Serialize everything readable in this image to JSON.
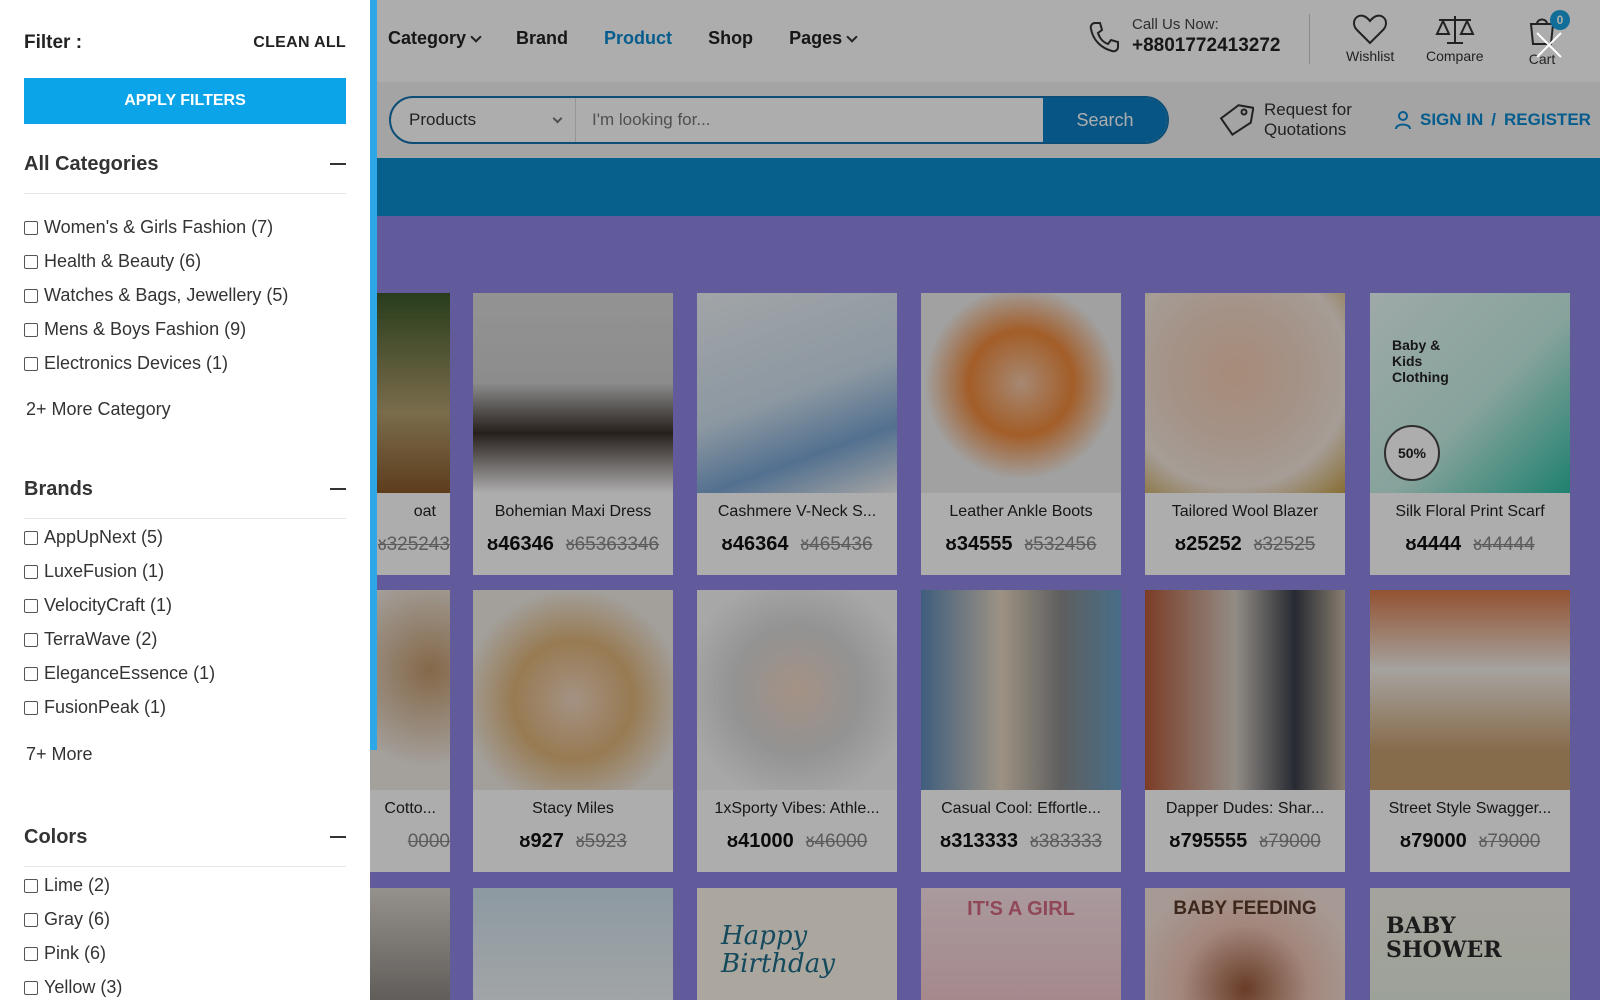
{
  "header": {
    "nav": [
      {
        "label": "Category",
        "dropdown": true,
        "active": false
      },
      {
        "label": "Brand",
        "dropdown": false,
        "active": false
      },
      {
        "label": "Product",
        "dropdown": false,
        "active": true
      },
      {
        "label": "Shop",
        "dropdown": false,
        "active": false
      },
      {
        "label": "Pages",
        "dropdown": true,
        "active": false
      }
    ],
    "call_label": "Call Us Now:",
    "phone": "+8801772413272",
    "wishlist_label": "Wishlist",
    "compare_label": "Compare",
    "cart_label": "Cart",
    "cart_count": "0"
  },
  "search": {
    "category": "Products",
    "placeholder": "I'm looking for...",
    "button": "Search"
  },
  "rfq": {
    "line1": "Request for",
    "line2": "Quotations"
  },
  "auth": {
    "sign_in": "SIGN IN",
    "divider": "/",
    "register": "REGISTER"
  },
  "products": [
    {
      "name": "oat",
      "price": "",
      "old": "ᴕ325243"
    },
    {
      "name": "Bohemian Maxi Dress",
      "price": "ᴕ46346",
      "old": "ᴕ65363346"
    },
    {
      "name": "Cashmere V-Neck S...",
      "price": "ᴕ46364",
      "old": "ᴕ465436"
    },
    {
      "name": "Leather Ankle Boots",
      "price": "ᴕ34555",
      "old": "ᴕ532456"
    },
    {
      "name": "Tailored Wool Blazer",
      "price": "ᴕ25252",
      "old": "ᴕ32525"
    },
    {
      "name": "Silk Floral Print Scarf",
      "price": "ᴕ4444",
      "old": "ᴕ44444"
    },
    {
      "name": "Cotto...",
      "price": "",
      "old": "0000"
    },
    {
      "name": "Stacy Miles",
      "price": "ᴕ927",
      "old": "ᴕ5923"
    },
    {
      "name": "1xSporty Vibes: Athle...",
      "price": "ᴕ41000",
      "old": "ᴕ46000"
    },
    {
      "name": "Casual Cool: Effortle...",
      "price": "ᴕ313333",
      "old": "ᴕ383333"
    },
    {
      "name": "Dapper Dudes: Shar...",
      "price": "ᴕ795555",
      "old": "ᴕ79000"
    },
    {
      "name": "Street Style Swagger...",
      "price": "ᴕ79000",
      "old": "ᴕ79000"
    },
    {
      "name": "",
      "price": "",
      "old": ""
    },
    {
      "name": "",
      "price": "",
      "old": ""
    },
    {
      "name": "",
      "price": "",
      "old": ""
    },
    {
      "name": "",
      "price": "",
      "old": ""
    },
    {
      "name": "",
      "price": "",
      "old": ""
    },
    {
      "name": "",
      "price": "",
      "old": ""
    }
  ],
  "banner_texts": {
    "kids_title": "Baby & Kids Clothing",
    "kids_discount": "50%",
    "birthday": "Happy Birthday",
    "girl": "IT'S A GIRL",
    "feeding": "BABY FEEDING",
    "shower": "BABY SHOWER"
  },
  "filter": {
    "title": "Filter :",
    "clean_all": "CLEAN ALL",
    "apply": "APPLY FILTERS",
    "categories": {
      "title": "All Categories",
      "items": [
        "Women's & Girls Fashion (7)",
        "Health & Beauty (6)",
        "Watches & Bags, Jewellery (5)",
        "Mens & Boys Fashion (9)",
        "Electronics Devices (1)"
      ],
      "more": "2+ More Category"
    },
    "brands": {
      "title": "Brands",
      "items": [
        "AppUpNext (5)",
        "LuxeFusion (1)",
        "VelocityCraft (1)",
        "TerraWave (2)",
        "EleganceEssence (1)",
        "FusionPeak (1)"
      ],
      "more": "7+ More"
    },
    "colors": {
      "title": "Colors",
      "items": [
        "Lime (2)",
        "Gray (6)",
        "Pink (6)",
        "Yellow (3)"
      ]
    }
  }
}
